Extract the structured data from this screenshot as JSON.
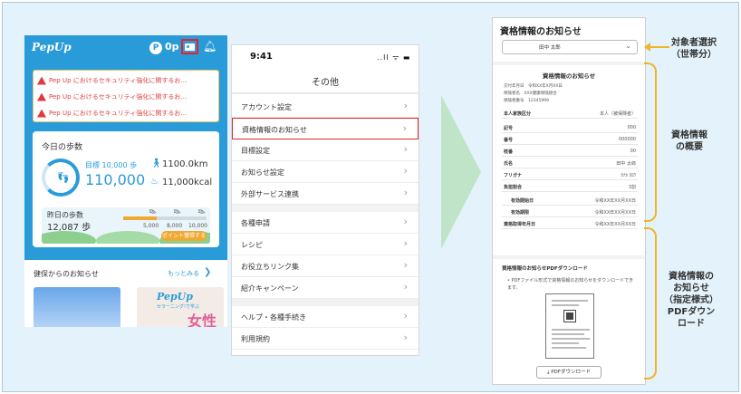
{
  "phone1": {
    "logo": "PepUp",
    "points_icon": "P",
    "points": "0p",
    "alerts": [
      "Pep Up におけるセキュリティ強化に関するお…",
      "Pep Up におけるセキュリティ強化に関するお…",
      "Pep Up におけるセキュリティ強化に関するお…"
    ],
    "steps_title": "今日の歩数",
    "goal": "目標 10,000 歩",
    "steps": "110,000",
    "km": "1100.0km",
    "kcal": "11,000kcal",
    "yesterday_title": "昨日の歩数",
    "yesterday_steps": "12,087 歩",
    "yesterday_progress": 0.4,
    "milestones": [
      "5,000",
      "8,000",
      "10,000"
    ],
    "point_button": "ポイント獲得する",
    "news_title": "健保からのお知らせ",
    "news_more": "もっとみる",
    "thumb_logo": "PepUp",
    "thumb_sub": "セラーニング!で学ぶ",
    "thumb_big": "女性"
  },
  "phone2": {
    "time": "9:41",
    "status": "..ll ᯤ ▬",
    "title": "その他",
    "items": [
      "アカウント設定",
      "資格情報のお知らせ",
      "目標設定",
      "お知らせ設定",
      "外部サービス連携",
      "各種申請",
      "レシピ",
      "お役立ちリンク集",
      "紹介キャンペーン",
      "ヘルプ・各種手続き",
      "利用規約"
    ]
  },
  "phone3": {
    "title": "資格情報のお知らせ",
    "dropdown": "田中 太郎",
    "subtitle": "資格情報のお知らせ",
    "meta": [
      "交付年月日　令和XX年X月XX日",
      "保険者名　XXX健康保険組合",
      "保険者番号　12345999"
    ],
    "rows": [
      {
        "k": "本人家族区分",
        "v": "本人（被保険者）"
      },
      {
        "k": "記号",
        "v": "000"
      },
      {
        "k": "番号",
        "v": "000000"
      },
      {
        "k": "枝番",
        "v": "00"
      },
      {
        "k": "氏名",
        "v": "田中 太郎"
      },
      {
        "k": "フリガナ",
        "v": "ﾀﾅｶ ﾀﾛｳ"
      },
      {
        "k": "負担割合",
        "v": "3割"
      },
      {
        "k": "有効開始日",
        "v": "令和XX年XX月XX日"
      },
      {
        "k": "有効期限",
        "v": "令和XX年XX月XX日"
      },
      {
        "k": "資格取得年月日",
        "v": "令和XX年XX月XX日"
      }
    ],
    "pdf_title": "資格情報のお知らせPDFダウンロード",
    "pdf_desc": "• PDFファイル形式で資格情報のお知らせをダウンロードできます。",
    "pdf_button": "⤓ PDFダウンロード"
  },
  "annotations": {
    "a1": "対象者選択\n（世帯分）",
    "a2": "資格情報\nの概要",
    "a3": "資格情報の\nお知らせ\n（指定様式）\nPDFダウン\nロード"
  },
  "colors": {
    "brand": "#2a9bd9",
    "highlight": "#e3242b",
    "annotation": "#f0b429",
    "arrow": "#bfe4c8"
  }
}
